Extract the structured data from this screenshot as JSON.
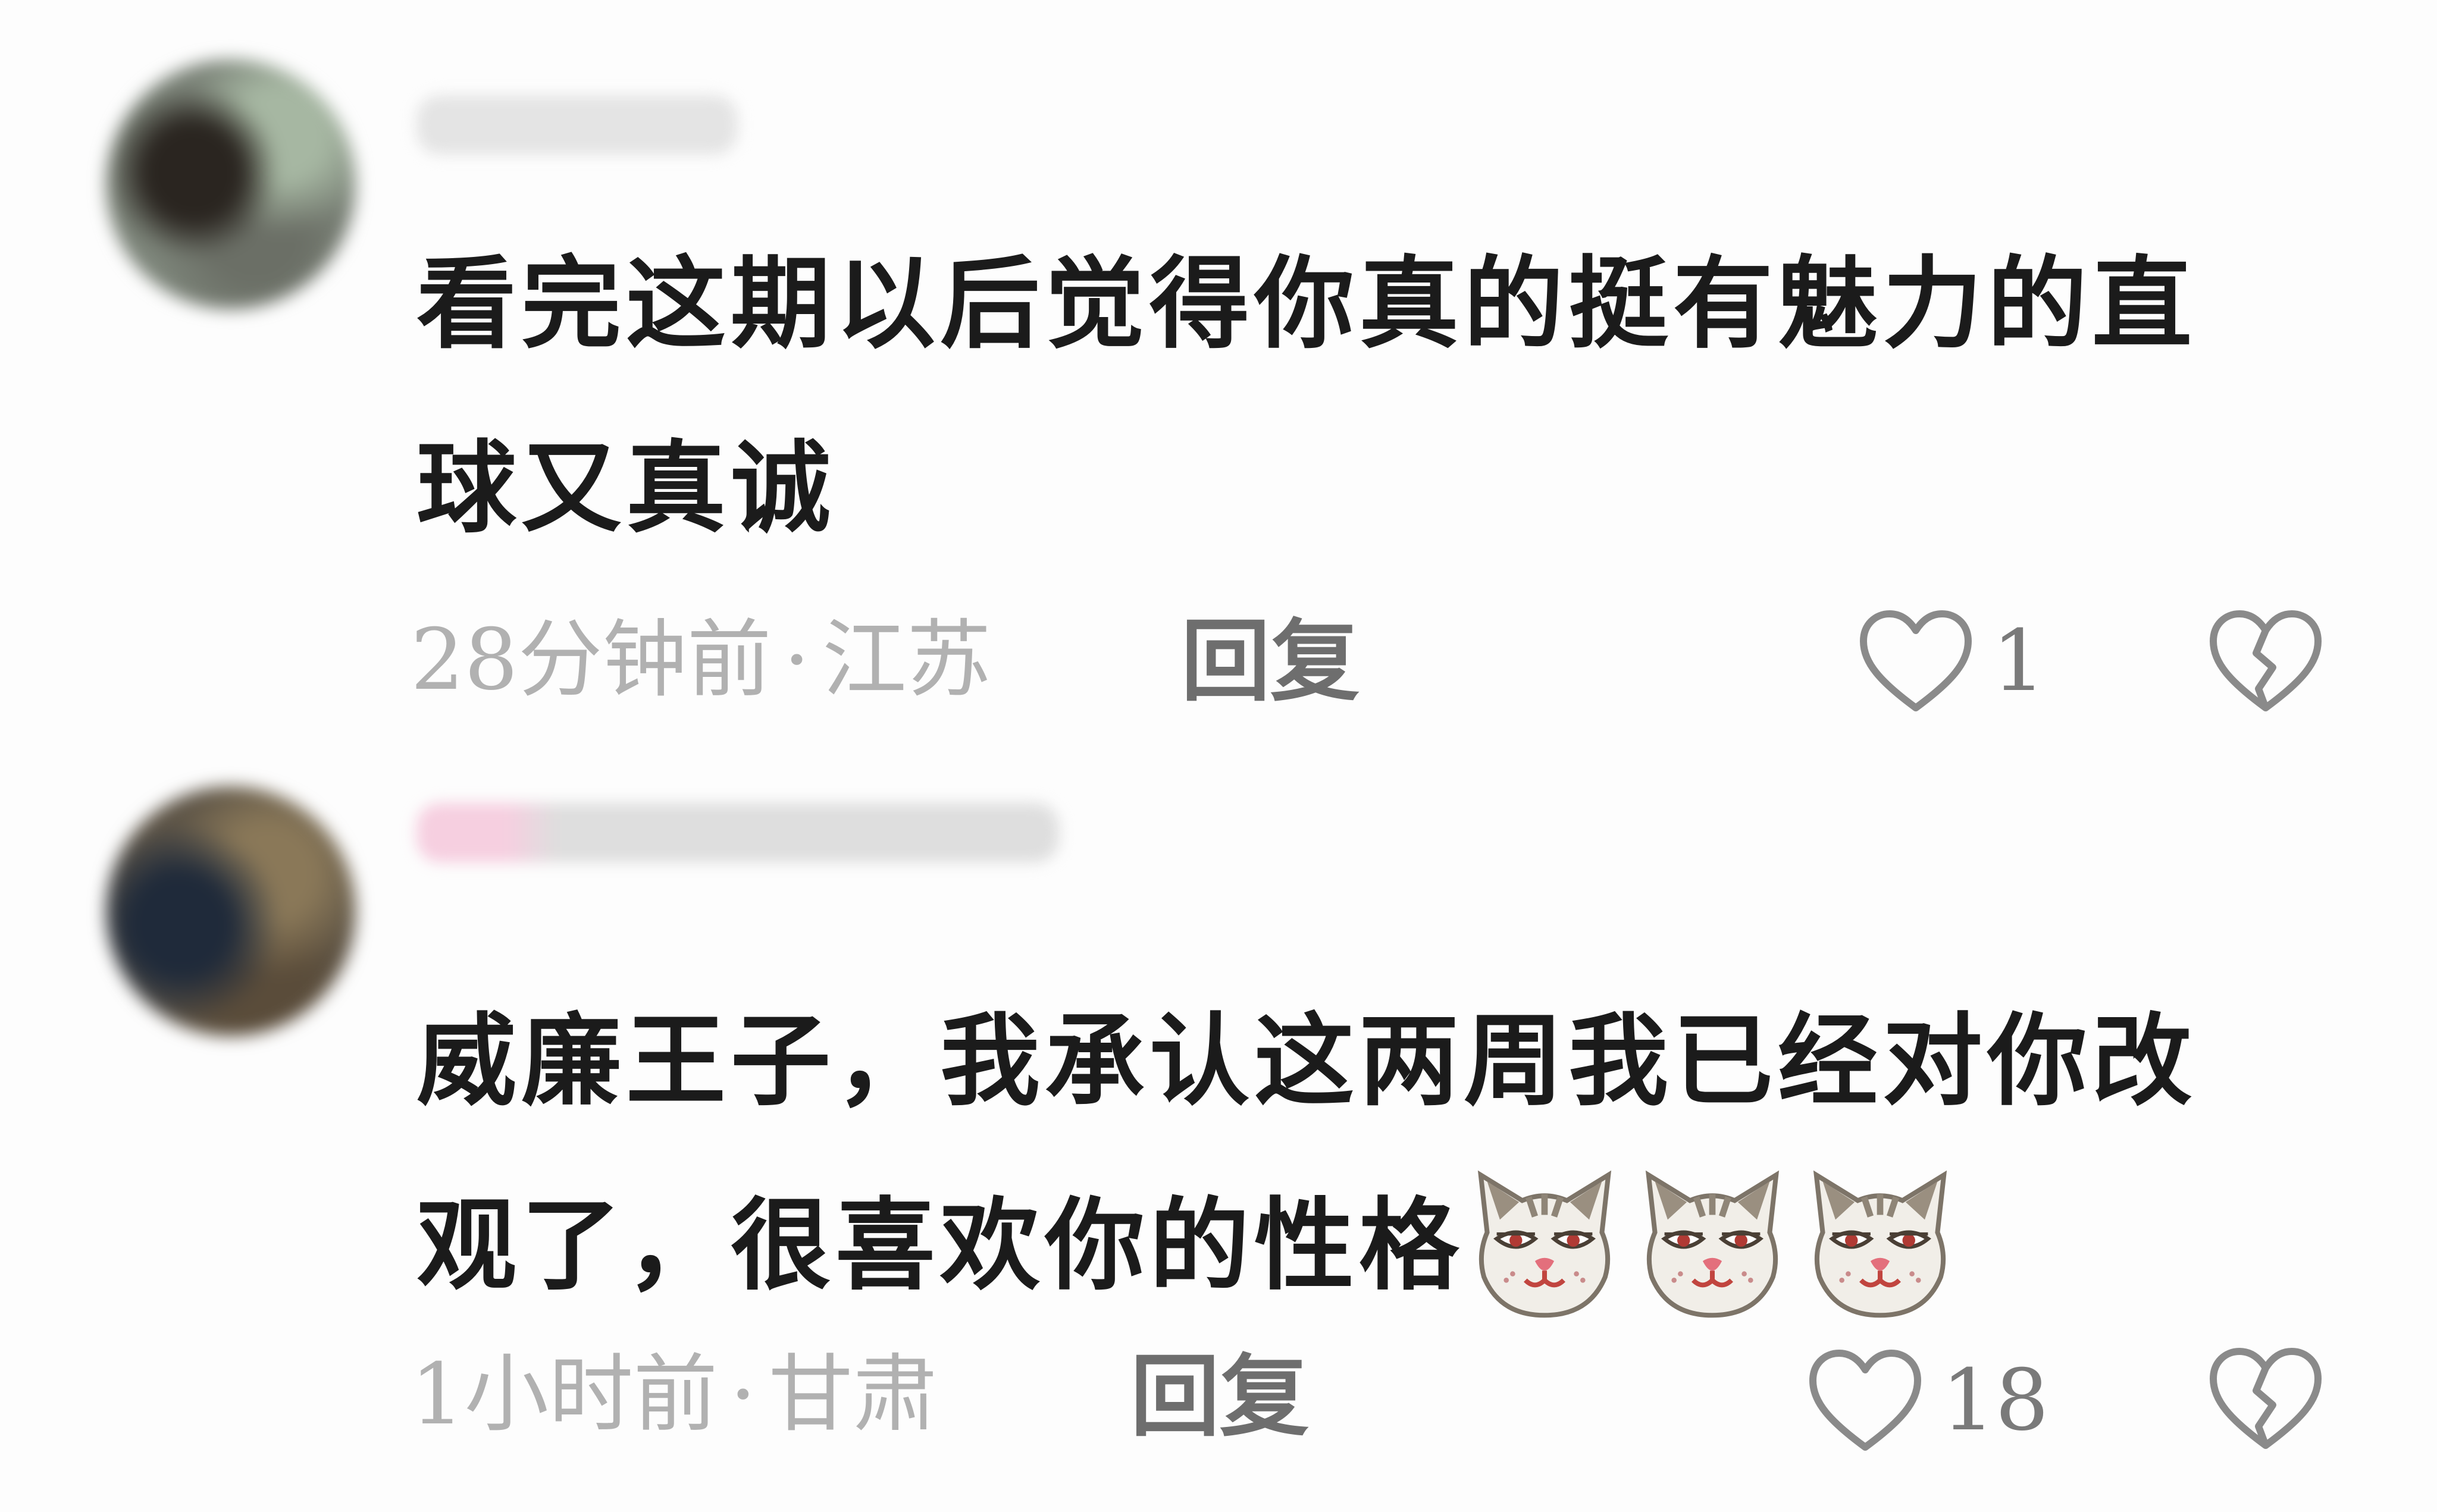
{
  "comments": [
    {
      "text": "看完这期以后觉得你真的挺有魅力的直球又真诚",
      "time": "28分钟前",
      "location": "江苏",
      "reply_label": "回复",
      "likes": "1",
      "emoji_count": 0
    },
    {
      "text": "威廉王子，我承认这两周我已经对你改观了，很喜欢你的性格",
      "time": "1小时前",
      "location": "甘肃",
      "reply_label": "回复",
      "likes": "18",
      "emoji_count": 3,
      "emoji_name": "cat-face-emoji"
    }
  ],
  "separator": "·",
  "icons": {
    "like": "heart-outline-icon",
    "dislike": "broken-heart-icon"
  },
  "colors": {
    "background": "#fdfdfd",
    "text": "#1b1b1b",
    "meta": "#b1b1b1",
    "reply": "#6e6e6e",
    "icon": "#8a8a8a"
  }
}
